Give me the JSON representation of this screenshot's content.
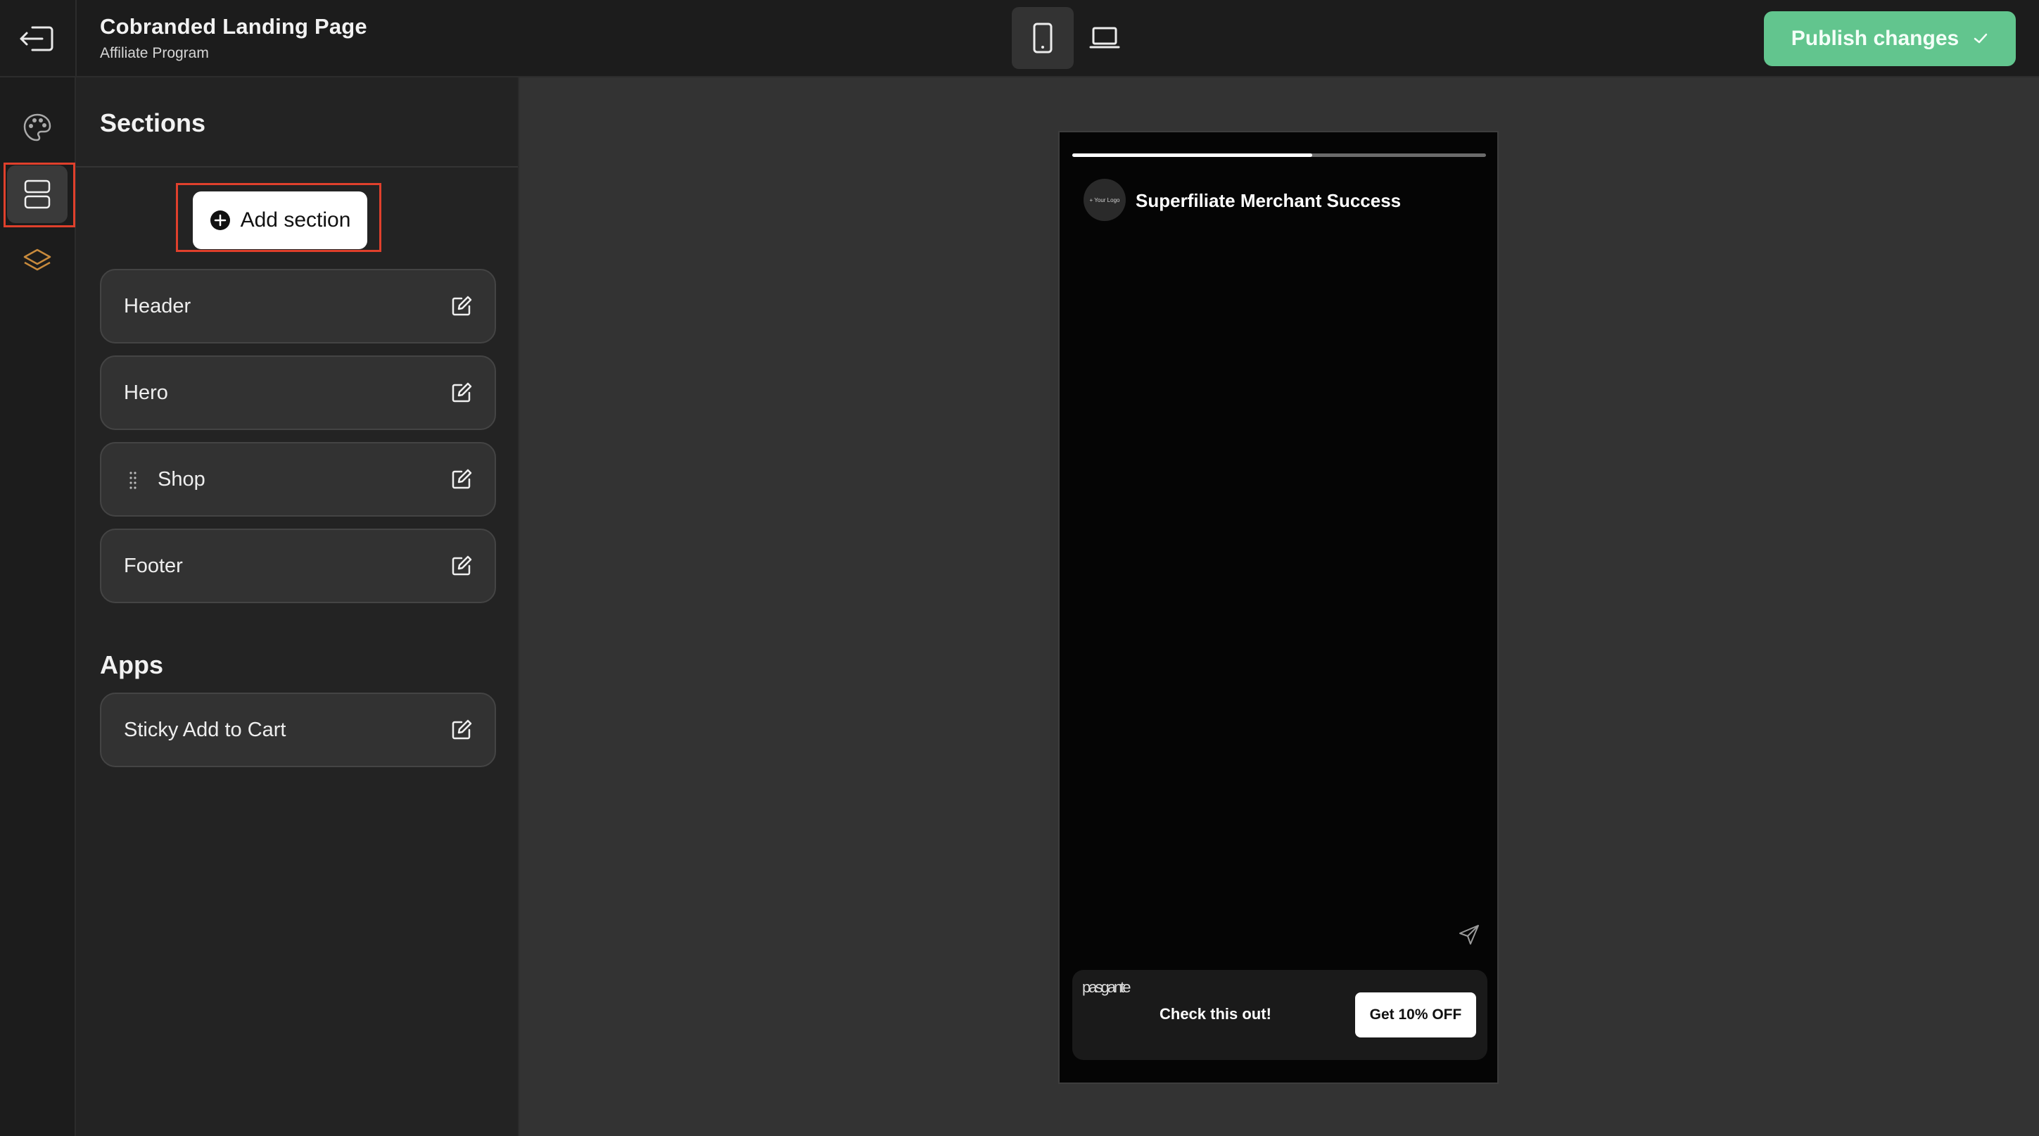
{
  "header": {
    "title": "Cobranded Landing Page",
    "subtitle": "Affiliate Program",
    "exit_icon": "exit-icon",
    "device_toggle": {
      "mobile_icon": "mobile-icon",
      "desktop_icon": "laptop-icon",
      "selected": "mobile"
    },
    "publish_label": "Publish changes",
    "publish_icon": "check-icon"
  },
  "rail": {
    "items": [
      {
        "icon": "palette-icon",
        "active": false
      },
      {
        "icon": "sections-icon",
        "active": true
      },
      {
        "icon": "layers-icon",
        "active": false
      }
    ]
  },
  "panel": {
    "title": "Sections",
    "add_label": "Add section",
    "sections": [
      {
        "label": "Header"
      },
      {
        "label": "Hero"
      },
      {
        "label": "Shop"
      },
      {
        "label": "Footer"
      }
    ],
    "apps_title": "Apps",
    "apps": [
      {
        "label": "Sticky Add to Cart"
      }
    ]
  },
  "preview": {
    "progress": 0.58,
    "logo_text": "+ Your Logo",
    "brand_name": "Superfiliate Merchant Success",
    "share_icon": "send-icon",
    "promo": {
      "thumb_text": "pasgante",
      "text": "Check this out!",
      "button_label": "Get 10% OFF"
    }
  },
  "colors": {
    "accent_green": "#62c58e",
    "highlight_red": "#e0402c",
    "layers_icon_orange": "#c88a3c"
  }
}
